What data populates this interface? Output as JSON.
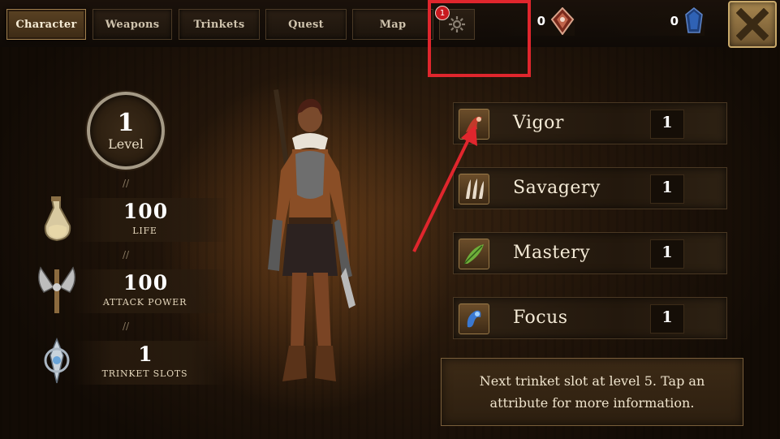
{
  "tabs": [
    {
      "label": "Character",
      "active": true
    },
    {
      "label": "Weapons",
      "active": false
    },
    {
      "label": "Trinkets",
      "active": false
    },
    {
      "label": "Quest",
      "active": false
    },
    {
      "label": "Map",
      "active": false
    }
  ],
  "settings": {
    "icon": "gear-icon",
    "badge": "1"
  },
  "currencies": [
    {
      "value": "0",
      "icon": "red-gem-icon"
    },
    {
      "value": "0",
      "icon": "blue-crystal-icon"
    }
  ],
  "close": {
    "icon": "close-icon"
  },
  "level": {
    "value": "1",
    "label": "Level"
  },
  "stats": [
    {
      "value": "100",
      "label": "LIFE",
      "icon": "potion-icon"
    },
    {
      "value": "100",
      "label": "ATTACK POWER",
      "icon": "axe-icon"
    },
    {
      "value": "1",
      "label": "TRINKET SLOTS",
      "icon": "amulet-icon"
    }
  ],
  "attributes": [
    {
      "name": "Vigor",
      "value": "1",
      "icon": "vigor-icon"
    },
    {
      "name": "Savagery",
      "value": "1",
      "icon": "claw-icon"
    },
    {
      "name": "Mastery",
      "value": "1",
      "icon": "feather-icon"
    },
    {
      "name": "Focus",
      "value": "1",
      "icon": "focus-icon"
    }
  ],
  "info": "Next trinket slot at level 5. Tap an attribute for more information.",
  "colors": {
    "highlight": "#e0262d",
    "badge": "#c9191f",
    "accent_gold": "#a1804e"
  }
}
